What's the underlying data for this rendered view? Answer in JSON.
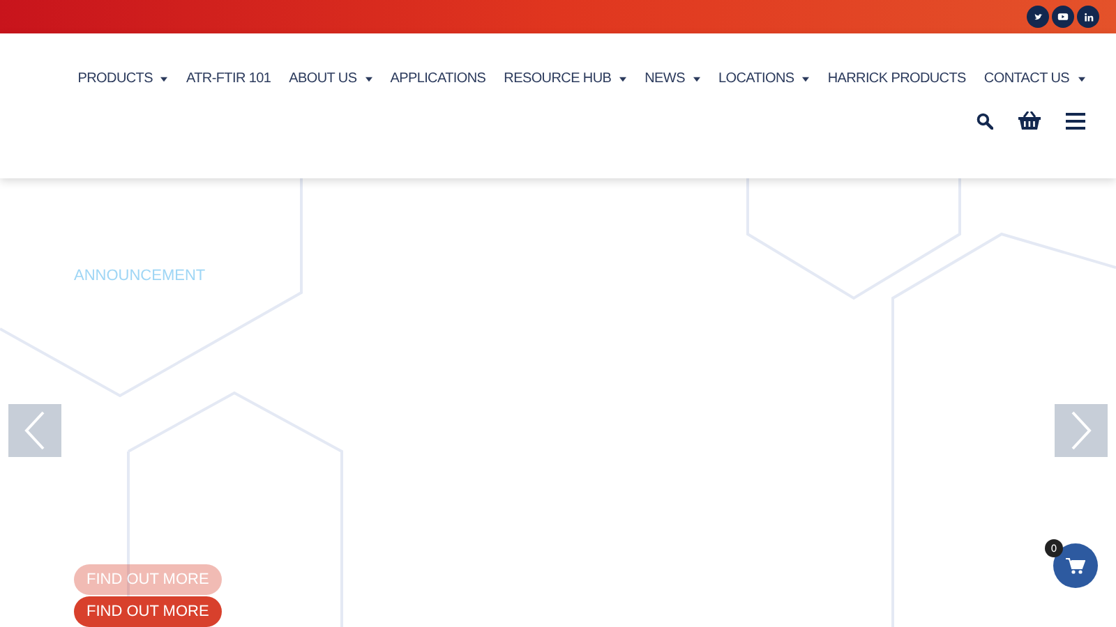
{
  "social": [
    {
      "kind": "twitter"
    },
    {
      "kind": "youtube"
    },
    {
      "kind": "linkedin"
    }
  ],
  "nav": [
    {
      "label": "PRODUCTS",
      "dropdown": true
    },
    {
      "label": "ATR-FTIR 101",
      "dropdown": false
    },
    {
      "label": "ABOUT US",
      "dropdown": true
    },
    {
      "label": "APPLICATIONS",
      "dropdown": false
    },
    {
      "label": "RESOURCE HUB",
      "dropdown": true
    },
    {
      "label": "NEWS",
      "dropdown": true
    },
    {
      "label": "LOCATIONS",
      "dropdown": true
    },
    {
      "label": "HARRICK PRODUCTS",
      "dropdown": false
    },
    {
      "label": "CONTACT US",
      "dropdown": true
    }
  ],
  "slide": {
    "eyebrow": "ANNOUNCEMENT",
    "buttons": [
      {
        "label": "FIND OUT MORE",
        "faded": true
      },
      {
        "label": "FIND OUT MORE",
        "faded": false
      }
    ]
  },
  "cart": {
    "count": "0"
  }
}
